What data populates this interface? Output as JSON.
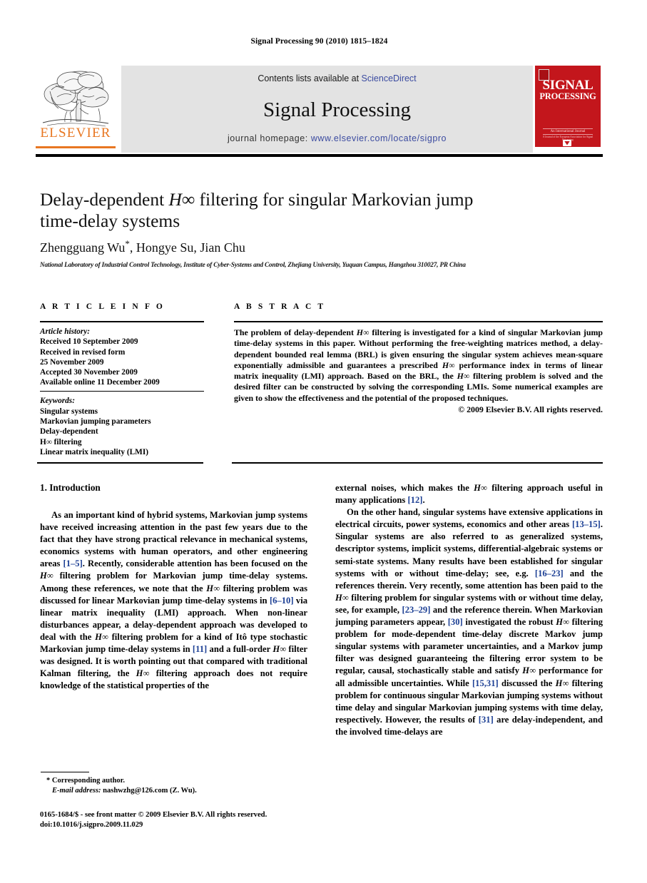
{
  "running_head": "Signal Processing 90 (2010) 1815–1824",
  "masthead": {
    "contents_prefix": "Contents lists available at ",
    "contents_link": "ScienceDirect",
    "journal_name": "Signal Processing",
    "homepage_prefix": "journal homepage: ",
    "homepage_link": "www.elsevier.com/locate/sigpro",
    "publisher_wordmark": "ELSEVIER",
    "cover": {
      "title_line1": "SIGNAL",
      "title_line2": "PROCESSING",
      "subtitle": "An International Journal",
      "subtitle2": "A Journal of the European Association for Signal Processing"
    },
    "colors": {
      "link_blue": "#3b4ba0",
      "elsevier_orange": "#E87722",
      "cover_red": "#c3161c",
      "box_grey": "#e3e3e3"
    }
  },
  "article": {
    "title_line1": "Delay-dependent ",
    "title_math": "H∞",
    "title_line1b": " filtering for singular Markovian jump",
    "title_line2": "time-delay systems",
    "authors": "Zhengguang Wu",
    "corresponding_marker": "*",
    "authors_rest": ", Hongye Su, Jian Chu",
    "affiliation": "National Laboratory of Industrial Control Technology, Institute of Cyber-Systems and Control, Zhejiang University, Yuquan Campus, Hangzhou 310027, PR China"
  },
  "info": {
    "heading": "A R T I C L E   I N F O",
    "history_label": "Article history:",
    "history": [
      "Received 10 September 2009",
      "Received in revised form",
      "25 November 2009",
      "Accepted 30 November 2009",
      "Available online 11 December 2009"
    ],
    "keywords_label": "Keywords:",
    "keywords": [
      "Singular systems",
      "Markovian jumping parameters",
      "Delay-dependent",
      "H∞ filtering",
      "Linear matrix inequality (LMI)"
    ]
  },
  "abstract": {
    "heading": "A B S T R A C T",
    "text_1": "The problem of delay-dependent ",
    "math_1": "H∞",
    "text_2": " filtering is investigated for a kind of singular Markovian jump time-delay systems in this paper. Without performing the free-weighting matrices method, a delay-dependent bounded real lemma (BRL) is given ensuring the singular system achieves mean-square exponentially admissible and guarantees a prescribed ",
    "math_2": "H∞",
    "text_3": " performance index in terms of linear matrix inequality (LMI) approach. Based on the BRL, the ",
    "math_3": "H∞",
    "text_4": " filtering problem is solved and the desired filter can be constructed by solving the corresponding LMIs. Some numerical examples are given to show the effectiveness and the potential of the proposed techniques.",
    "copyright": "© 2009 Elsevier B.V. All rights reserved."
  },
  "body": {
    "section_heading": "1.  Introduction",
    "left_p1_a": "As an important kind of hybrid systems, Markovian jump systems have received increasing attention in the past few years due to the fact that they have strong practical relevance in mechanical systems, economics systems with human operators, and other engineering areas ",
    "left_p1_ref1": "[1–5]",
    "left_p1_b": ". Recently, considerable attention has been focused on the ",
    "left_p1_m1": "H∞",
    "left_p1_c": " filtering problem for Markovian jump time-delay systems. Among these references, we note that the ",
    "left_p1_m2": "H∞",
    "left_p1_d": " filtering problem was discussed for linear Markovian jump time-delay systems in ",
    "left_p1_ref2": "[6–10]",
    "left_p1_e": " via linear matrix inequality (LMI) approach. When non-linear disturbances appear, a delay-dependent approach was developed to deal with the ",
    "left_p1_m3": "H∞",
    "left_p1_f": " filtering problem for a kind of Itô type stochastic Markovian jump time-delay systems in ",
    "left_p1_ref3": "[11]",
    "left_p1_g": " and a full-order ",
    "left_p1_m4": "H∞",
    "left_p1_h": " filter was designed. It is worth pointing out that compared with traditional Kalman filtering, the ",
    "left_p1_m5": "H∞",
    "left_p1_i": " filtering approach does not require knowledge of the statistical properties of the",
    "right_p1_a": "external noises, which makes the ",
    "right_p1_m1": "H∞",
    "right_p1_b": " filtering approach useful in many applications ",
    "right_p1_ref1": "[12]",
    "right_p1_c": ".",
    "right_p2_a": "On the other hand, singular systems have extensive applications in electrical circuits, power systems, economics and other areas ",
    "right_p2_ref1": "[13–15]",
    "right_p2_b": ". Singular systems are also referred to as generalized systems, descriptor systems, implicit systems, differential-algebraic systems or semi-state systems. Many results have been established for singular systems with or without time-delay; see, e.g. ",
    "right_p2_ref2": "[16–23]",
    "right_p2_c": " and the references therein. Very recently, some attention has been paid to the ",
    "right_p2_m1": "H∞",
    "right_p2_d": " filtering problem for singular systems with or without time delay, see, for example, ",
    "right_p2_ref3": "[23–29]",
    "right_p2_e": " and the reference therein. When Markovian jumping parameters appear, ",
    "right_p2_ref4": "[30]",
    "right_p2_f": " investigated the robust ",
    "right_p2_m2": "H∞",
    "right_p2_g": " filtering problem for mode-dependent time-delay discrete Markov jump singular systems with parameter uncertainties, and a Markov jump filter was designed guaranteeing the filtering error system to be regular, causal, stochastically stable and satisfy ",
    "right_p2_m3": "H∞",
    "right_p2_h": " performance for all admissible uncertainties. While ",
    "right_p2_ref5": "[15,31]",
    "right_p2_i": " discussed the ",
    "right_p2_m4": "H∞",
    "right_p2_j": " filtering problem for continuous singular Markovian jumping systems without time delay and singular Markovian jumping systems with time delay, respectively. However, the results of ",
    "right_p2_ref6": "[31]",
    "right_p2_k": " are delay-independent, and the involved time-delays are"
  },
  "footer": {
    "corresponding": "* Corresponding author.",
    "email_label": "E-mail address:",
    "email_value": " nashwzhg@126.com (Z. Wu).",
    "imprint_line1": "0165-1684/$ - see front matter © 2009 Elsevier B.V. All rights reserved.",
    "imprint_line2": "doi:10.1016/j.sigpro.2009.11.029"
  }
}
